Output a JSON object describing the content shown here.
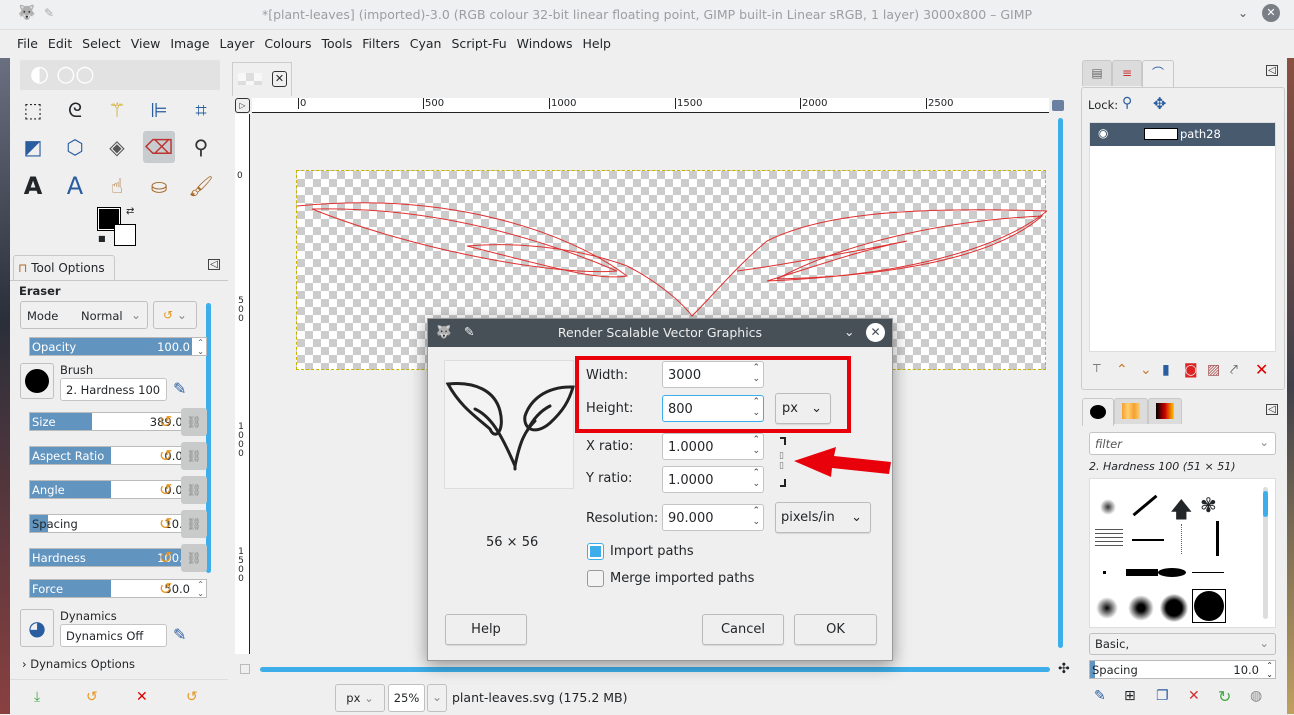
{
  "window": {
    "title": "*[plant-leaves] (imported)-3.0 (RGB colour 32-bit linear floating point, GIMP built-in Linear sRGB, 1 layer) 3000x800 – GIMP"
  },
  "menu": [
    "File",
    "Edit",
    "Select",
    "View",
    "Image",
    "Layer",
    "Colours",
    "Tools",
    "Filters",
    "Cyan",
    "Script-Fu",
    "Windows",
    "Help"
  ],
  "tool_options": {
    "tab_label": "Tool Options",
    "tool_name": "Eraser",
    "mode_label": "Mode",
    "mode_value": "Normal",
    "opacity": {
      "label": "Opacity",
      "value": "100.0",
      "fraction": 1.0
    },
    "brush_label": "Brush",
    "brush_value": "2. Hardness 100",
    "sliders": [
      {
        "label": "Size",
        "value": "389.00",
        "fraction": 0.37
      },
      {
        "label": "Aspect Ratio",
        "value": "0.00",
        "fraction": 0.5
      },
      {
        "label": "Angle",
        "value": "0.00",
        "fraction": 0.5
      },
      {
        "label": "Spacing",
        "value": "10.0",
        "fraction": 0.1
      },
      {
        "label": "Hardness",
        "value": "100.0",
        "fraction": 1.0
      },
      {
        "label": "Force",
        "value": "50.0",
        "fraction": 0.5
      }
    ],
    "dynamics_label": "Dynamics",
    "dynamics_value": "Dynamics Off",
    "dynamics_options": "Dynamics Options"
  },
  "ruler": {
    "ticks": [
      "0",
      "500",
      "1000",
      "1500",
      "2000",
      "2500"
    ],
    "vticks": [
      "0",
      "500",
      "1000",
      "1500"
    ]
  },
  "statusbar": {
    "unit": "px",
    "zoom": "25",
    "zoom_unit": "%",
    "file_info": "plant-leaves.svg (175.2 MB)"
  },
  "dialog": {
    "title": "Render Scalable Vector Graphics",
    "preview_size": "56 × 56",
    "width_label": "Width:",
    "width_value": "3000",
    "height_label": "Height:",
    "height_value": "800",
    "size_unit": "px",
    "xratio_label": "X ratio:",
    "xratio_value": "1.0000",
    "yratio_label": "Y ratio:",
    "yratio_value": "1.0000",
    "resolution_label": "Resolution:",
    "resolution_value": "90.000",
    "resolution_unit": "pixels/in",
    "import_paths": {
      "label": "Import paths",
      "checked": true
    },
    "merge_paths": {
      "label": "Merge imported paths",
      "checked": false
    },
    "help": "Help",
    "cancel": "Cancel",
    "ok": "OK",
    "highlight_color": "#e8000b"
  },
  "paths_panel": {
    "lock_label": "Lock:",
    "items": [
      {
        "name": "path28",
        "visible": true
      }
    ]
  },
  "brushes_panel": {
    "filter_placeholder": "filter",
    "selected_brush": "2. Hardness 100 (51 × 51)",
    "tag": "Basic,",
    "spacing_label": "Spacing",
    "spacing_value": "10.0"
  }
}
